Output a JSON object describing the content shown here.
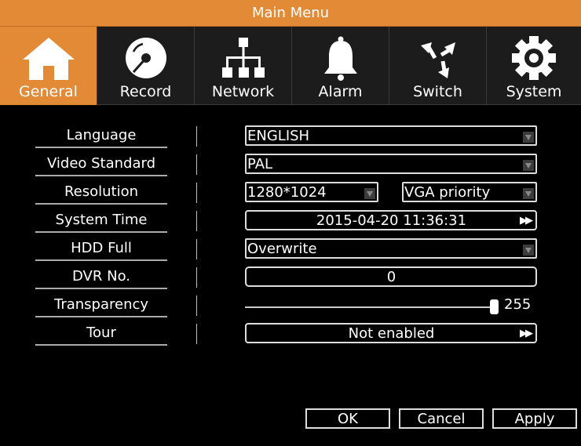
{
  "window": {
    "title": "Main Menu"
  },
  "tabs": [
    {
      "label": "General",
      "icon": "home-icon",
      "active": true
    },
    {
      "label": "Record",
      "icon": "disc-icon"
    },
    {
      "label": "Network",
      "icon": "network-icon"
    },
    {
      "label": "Alarm",
      "icon": "bell-icon"
    },
    {
      "label": "Switch",
      "icon": "switch-arrows-icon"
    },
    {
      "label": "System",
      "icon": "gear-icon"
    }
  ],
  "settings": {
    "language": {
      "label": "Language",
      "value": "ENGLISH"
    },
    "video_standard": {
      "label": "Video Standard",
      "value": "PAL"
    },
    "resolution": {
      "label": "Resolution",
      "value": "1280*1024",
      "priority": "VGA priority"
    },
    "system_time": {
      "label": "System Time",
      "value": "2015-04-20 11:36:31"
    },
    "hdd_full": {
      "label": "HDD Full",
      "value": "Overwrite"
    },
    "dvr_no": {
      "label": "DVR No.",
      "value": "0"
    },
    "transparency": {
      "label": "Transparency",
      "value": "255",
      "level_fraction": 1.0
    },
    "tour": {
      "label": "Tour",
      "value": "Not enabled"
    }
  },
  "buttons": {
    "ok": "OK",
    "cancel": "Cancel",
    "apply": "Apply"
  },
  "colors": {
    "accent": "#e38a37",
    "tab_bg": "#1c1c1c",
    "panel_bg": "#000000"
  }
}
